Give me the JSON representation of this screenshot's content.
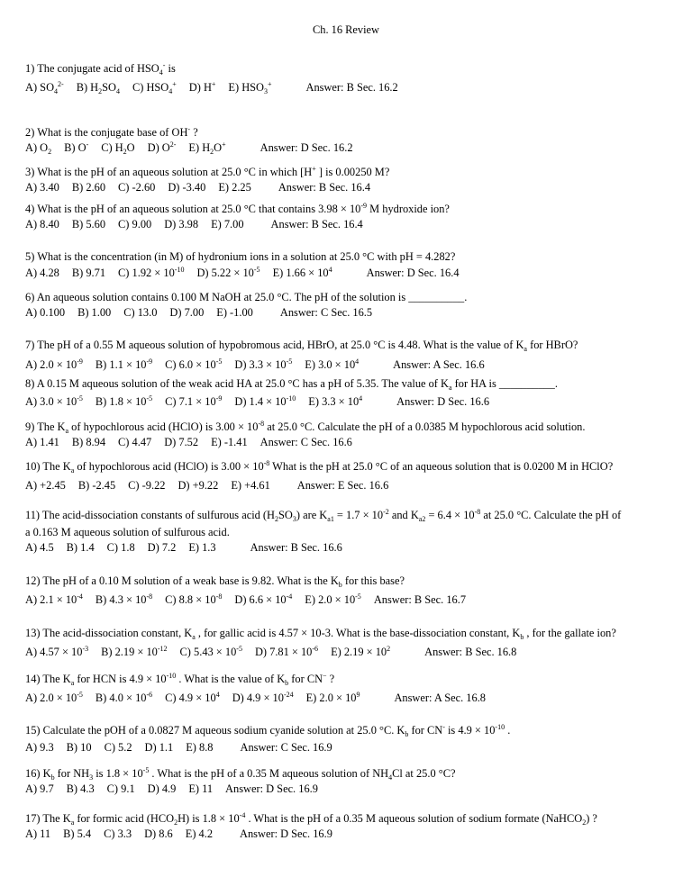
{
  "document": {
    "title": "Ch. 16 Review",
    "questions": [
      {
        "number": 1,
        "stem": [
          [
            {
              "t": "1)  The conjugate acid of  HSO"
            },
            {
              "sub": "4"
            },
            {
              "sup": "-"
            },
            {
              "t": "  is"
            }
          ]
        ],
        "options": [
          [
            {
              "t": "A) SO"
            },
            {
              "sub": "4"
            },
            {
              "sup": "2-"
            }
          ],
          [
            {
              "t": "B) H"
            },
            {
              "sub": "2"
            },
            {
              "t": "SO"
            },
            {
              "sub": "4"
            }
          ],
          [
            {
              "t": "C) HSO"
            },
            {
              "sub": "4"
            },
            {
              "sup": "+"
            }
          ],
          [
            {
              "t": "D) H"
            },
            {
              "sup": "+"
            }
          ],
          [
            {
              "t": "E) HSO"
            },
            {
              "sub": "3"
            },
            {
              "sup": "+"
            }
          ]
        ],
        "answer": "Answer: B   Sec. 16.2"
      },
      {
        "number": 2,
        "stem": [
          [
            {
              "t": "2)  What is the conjugate base of  OH"
            },
            {
              "sup": "-"
            },
            {
              "t": " ?"
            }
          ]
        ],
        "options": [
          [
            {
              "t": "A) O"
            },
            {
              "sub": "2"
            }
          ],
          [
            {
              "t": "B) O"
            },
            {
              "sup": "-"
            }
          ],
          [
            {
              "t": "C) H"
            },
            {
              "sub": "2"
            },
            {
              "t": "O"
            }
          ],
          [
            {
              "t": "D) O"
            },
            {
              "sup": "2-"
            }
          ],
          [
            {
              "t": "E) H"
            },
            {
              "sub": "2"
            },
            {
              "t": "O"
            },
            {
              "sup": "+"
            }
          ]
        ],
        "answer": "Answer: D  Sec. 16.2"
      },
      {
        "number": 3,
        "stem": [
          [
            {
              "t": "3)  What is the pH of an aqueous solution at 25.0 °C in which  [H"
            },
            {
              "sup": "+"
            },
            {
              "t": " ]  is 0.00250 M?"
            }
          ]
        ],
        "options": [
          [
            {
              "t": "A) 3.40"
            }
          ],
          [
            {
              "t": "B) 2.60"
            }
          ],
          [
            {
              "t": "C) -2.60"
            }
          ],
          [
            {
              "t": "D) -3.40"
            }
          ],
          [
            {
              "t": "E) 2.25"
            }
          ]
        ],
        "answer": "Answer: B   Sec. 16.4"
      },
      {
        "number": 4,
        "stem": [
          [
            {
              "t": "4)  What is the pH of an aqueous solution at 25.0 °C that contains 3.98 × 10"
            },
            {
              "sup": "-9"
            },
            {
              "t": "  M hydroxide ion?"
            }
          ]
        ],
        "options": [
          [
            {
              "t": "A) 8.40"
            }
          ],
          [
            {
              "t": "B) 5.60"
            }
          ],
          [
            {
              "t": "C) 9.00"
            }
          ],
          [
            {
              "t": "D) 3.98"
            }
          ],
          [
            {
              "t": "E) 7.00"
            }
          ]
        ],
        "answer": "Answer: B  Sec. 16.4"
      },
      {
        "number": 5,
        "stem": [
          [
            {
              "t": "5)  What is the concentration (in M) of hydronium ions in a solution at 25.0 °C with pH = 4.282?"
            }
          ]
        ],
        "options": [
          [
            {
              "t": "A) 4.28"
            }
          ],
          [
            {
              "t": "B) 9.71"
            }
          ],
          [
            {
              "t": "C) 1.92 × 10"
            },
            {
              "sup": "-10"
            }
          ],
          [
            {
              "t": "D) 5.22 × 10"
            },
            {
              "sup": "-5"
            }
          ],
          [
            {
              "t": "E) 1.66 × 10"
            },
            {
              "sup": "4"
            }
          ]
        ],
        "answer": "Answer: D  Sec. 16.4"
      },
      {
        "number": 6,
        "stem": [
          [
            {
              "t": "6)  An aqueous solution contains 0.100 M NaOH at 25.0 °C.  The pH of the solution is __________."
            }
          ]
        ],
        "options": [
          [
            {
              "t": "A) 0.100"
            }
          ],
          [
            {
              "t": "B) 1.00"
            }
          ],
          [
            {
              "t": "C) 13.0"
            }
          ],
          [
            {
              "t": "D) 7.00"
            }
          ],
          [
            {
              "t": "E) -1.00"
            }
          ]
        ],
        "answer": "Answer: C  Sec. 16.5"
      },
      {
        "number": 7,
        "stem": [
          [
            {
              "t": "7)  The pH of a 0.55 M aqueous solution of hypobromous acid, HBrO, at 25.0 °C is 4.48. What is the value of  K"
            },
            {
              "sub": "a"
            },
            {
              "t": "  for HBrO?"
            }
          ]
        ],
        "options": [
          [
            {
              "t": "A) 2.0 × 10"
            },
            {
              "sup": "-9"
            }
          ],
          [
            {
              "t": "B) 1.1 × 10"
            },
            {
              "sup": "-9"
            }
          ],
          [
            {
              "t": "C) 6.0 × 10"
            },
            {
              "sup": "-5"
            }
          ],
          [
            {
              "t": "D) 3.3 × 10"
            },
            {
              "sup": "-5"
            }
          ],
          [
            {
              "t": "E) 3.0 × 10"
            },
            {
              "sup": "4"
            }
          ]
        ],
        "answer": "Answer: A  Sec. 16.6"
      },
      {
        "number": 8,
        "stem": [
          [
            {
              "t": "8)  A 0.15 M aqueous solution of the weak acid HA at 25.0 °C has a pH of 5.35. The value of  K"
            },
            {
              "sub": "a"
            },
            {
              "t": "  for HA is __________."
            }
          ]
        ],
        "options": [
          [
            {
              "t": "A) 3.0 × 10"
            },
            {
              "sup": "-5"
            }
          ],
          [
            {
              "t": "B) 1.8 × 10"
            },
            {
              "sup": "-5"
            }
          ],
          [
            {
              "t": "C) 7.1 × 10"
            },
            {
              "sup": "-9"
            }
          ],
          [
            {
              "t": "D) 1.4 × 10"
            },
            {
              "sup": "-10"
            }
          ],
          [
            {
              "t": "E) 3.3 × 10"
            },
            {
              "sup": "4"
            }
          ]
        ],
        "answer": "Answer: D  Sec. 16.6"
      },
      {
        "number": 9,
        "stem": [
          [
            {
              "t": "9)  The  K"
            },
            {
              "sub": "a"
            },
            {
              "t": "  of hypochlorous acid (HClO) is 3.00 × 10"
            },
            {
              "sup": "-8"
            },
            {
              "t": "  at 25.0 °C. Calculate the pH of a 0.0385 M hypochlorous acid solution."
            }
          ]
        ],
        "options": [
          [
            {
              "t": "A) 1.41"
            }
          ],
          [
            {
              "t": "B) 8.94"
            }
          ],
          [
            {
              "t": "C) 4.47"
            }
          ],
          [
            {
              "t": "D) 7.52"
            }
          ],
          [
            {
              "t": "E) -1.41"
            }
          ]
        ],
        "answer": "Answer: C  Sec. 16.6"
      },
      {
        "number": 10,
        "stem": [
          [
            {
              "t": "10)  The  K"
            },
            {
              "sub": "a"
            },
            {
              "t": "  of hypochlorous acid (HClO) is 3.00 × 10"
            },
            {
              "sup": "-8"
            },
            {
              "t": "  What is the pH at 25.0 °C of an aqueous solution that is 0.0200 M in HClO?"
            }
          ]
        ],
        "options": [
          [
            {
              "t": "A) +2.45"
            }
          ],
          [
            {
              "t": "B) -2.45"
            }
          ],
          [
            {
              "t": "C) -9.22"
            }
          ],
          [
            {
              "t": "D) +9.22"
            }
          ],
          [
            {
              "t": "E) +4.61"
            }
          ]
        ],
        "answer": "Answer: E  Sec. 16.6"
      },
      {
        "number": 11,
        "stem": [
          [
            {
              "t": "11)  The acid-dissociation constants of sulfurous acid  (H"
            },
            {
              "sub": "2"
            },
            {
              "t": "SO"
            },
            {
              "sub": "3"
            },
            {
              "t": ")  are  K"
            },
            {
              "sub": "a1"
            },
            {
              "t": " = 1.7  ×  10"
            },
            {
              "sup": "-2"
            },
            {
              "t": "  and  K"
            },
            {
              "sub": "a2"
            },
            {
              "t": " = 6.4  ×  10"
            },
            {
              "sup": "-8"
            },
            {
              "t": "  at 25.0 °C. Calculate the pH of"
            }
          ],
          [
            {
              "t": "a 0.163 M aqueous solution of sulfurous acid."
            }
          ]
        ],
        "options": [
          [
            {
              "t": "A) 4.5"
            }
          ],
          [
            {
              "t": "B) 1.4"
            }
          ],
          [
            {
              "t": "C) 1.8"
            }
          ],
          [
            {
              "t": "D) 7.2"
            }
          ],
          [
            {
              "t": "E) 1.3"
            }
          ]
        ],
        "answer": "Answer: B  Sec. 16.6"
      },
      {
        "number": 12,
        "stem": [
          [
            {
              "t": "12)  The pH of a 0.10 M solution of a weak base is 9.82. What is the  K"
            },
            {
              "sub": "b"
            },
            {
              "t": "  for this base?"
            }
          ]
        ],
        "options": [
          [
            {
              "t": "A) 2.1 × 10"
            },
            {
              "sup": "-4"
            }
          ],
          [
            {
              "t": "B) 4.3 × 10"
            },
            {
              "sup": "-8"
            }
          ],
          [
            {
              "t": "C) 8.8 × 10"
            },
            {
              "sup": "-8"
            }
          ],
          [
            {
              "t": "D) 6.6 × 10"
            },
            {
              "sup": "-4"
            }
          ],
          [
            {
              "t": "E) 2.0 × 10"
            },
            {
              "sup": "-5"
            }
          ]
        ],
        "answer": "Answer: B  Sec. 16.7"
      },
      {
        "number": 13,
        "stem": [
          [
            {
              "t": "13)  The acid-dissociation constant,  K"
            },
            {
              "sub": "a"
            },
            {
              "t": " , for gallic acid is 4.57 × 10-3. What is the base-dissociation constant,  K"
            },
            {
              "sub": "b"
            },
            {
              "t": " , for the gallate ion?"
            }
          ]
        ],
        "options": [
          [
            {
              "t": "A) 4.57 × 10"
            },
            {
              "sup": "-3"
            }
          ],
          [
            {
              "t": "B) 2.19 × 10"
            },
            {
              "sup": "-12"
            }
          ],
          [
            {
              "t": "C) 5.43 × 10"
            },
            {
              "sup": "-5"
            }
          ],
          [
            {
              "t": "D) 7.81 × 10"
            },
            {
              "sup": "-6"
            }
          ],
          [
            {
              "t": "E) 2.19 × 10"
            },
            {
              "sup": "2"
            }
          ]
        ],
        "answer": "Answer: B   Sec. 16.8"
      },
      {
        "number": 14,
        "stem": [
          [
            {
              "t": "14)  The  K"
            },
            {
              "sub": "a"
            },
            {
              "t": "  for HCN is 4.9 × 10"
            },
            {
              "sup": "-10"
            },
            {
              "t": " . What is the value of  K"
            },
            {
              "sub": "b"
            },
            {
              "t": "  for  CN"
            },
            {
              "sup": "−"
            },
            {
              "t": " ?"
            }
          ]
        ],
        "options": [
          [
            {
              "t": "A) 2.0 × 10"
            },
            {
              "sup": "-5"
            }
          ],
          [
            {
              "t": "B) 4.0 × 10"
            },
            {
              "sup": "-6"
            }
          ],
          [
            {
              "t": "C) 4.9 × 10"
            },
            {
              "sup": "4"
            }
          ],
          [
            {
              "t": "D) 4.9 × 10"
            },
            {
              "sup": "-24"
            }
          ],
          [
            {
              "t": "E) 2.0 × 10"
            },
            {
              "sup": "9"
            }
          ]
        ],
        "answer": "Answer: A  Sec. 16.8"
      },
      {
        "number": 15,
        "stem": [
          [
            {
              "t": "15)  Calculate the pOH of a 0.0827 M aqueous sodium cyanide solution at 25.0 °C.  K"
            },
            {
              "sub": "b"
            },
            {
              "t": "  for  CN"
            },
            {
              "sup": "-"
            },
            {
              "t": "  is 4.9 × 10"
            },
            {
              "sup": "-10"
            },
            {
              "t": " ."
            }
          ]
        ],
        "options": [
          [
            {
              "t": "A) 9.3"
            }
          ],
          [
            {
              "t": "B) 10"
            }
          ],
          [
            {
              "t": "C) 5.2"
            }
          ],
          [
            {
              "t": "D) 1.1"
            }
          ],
          [
            {
              "t": "E) 8.8"
            }
          ]
        ],
        "answer": "Answer: C  Sec. 16.9"
      },
      {
        "number": 16,
        "stem": [
          [
            {
              "t": "16)  K"
            },
            {
              "sub": "b"
            },
            {
              "t": "  for  NH"
            },
            {
              "sub": "3"
            },
            {
              "t": "  is 1.8 × 10"
            },
            {
              "sup": "-5"
            },
            {
              "t": " . What is the pH of a 0.35 M aqueous solution of  NH"
            },
            {
              "sub": "4"
            },
            {
              "t": "Cl  at 25.0 °C?"
            }
          ]
        ],
        "options": [
          [
            {
              "t": "A) 9.7"
            }
          ],
          [
            {
              "t": "B) 4.3"
            }
          ],
          [
            {
              "t": "C) 9.1"
            }
          ],
          [
            {
              "t": "D) 4.9"
            }
          ],
          [
            {
              "t": "E) 11"
            }
          ]
        ],
        "answer": "Answer: D  Sec. 16.9"
      },
      {
        "number": 17,
        "stem": [
          [
            {
              "t": "17)  The  K"
            },
            {
              "sub": "a"
            },
            {
              "t": "  for formic acid (HCO"
            },
            {
              "sub": "2"
            },
            {
              "t": "H) is 1.8 × 10"
            },
            {
              "sup": "-4"
            },
            {
              "t": " . What is the pH of a 0.35 M aqueous solution of sodium formate  (NaHCO"
            },
            {
              "sub": "2"
            },
            {
              "t": ") ?"
            }
          ]
        ],
        "options": [
          [
            {
              "t": "A) 11"
            }
          ],
          [
            {
              "t": "B) 5.4"
            }
          ],
          [
            {
              "t": "C) 3.3"
            }
          ],
          [
            {
              "t": "D) 8.6"
            }
          ],
          [
            {
              "t": "E) 4.2"
            }
          ]
        ],
        "answer": "Answer: D  Sec. 16.9"
      }
    ]
  }
}
